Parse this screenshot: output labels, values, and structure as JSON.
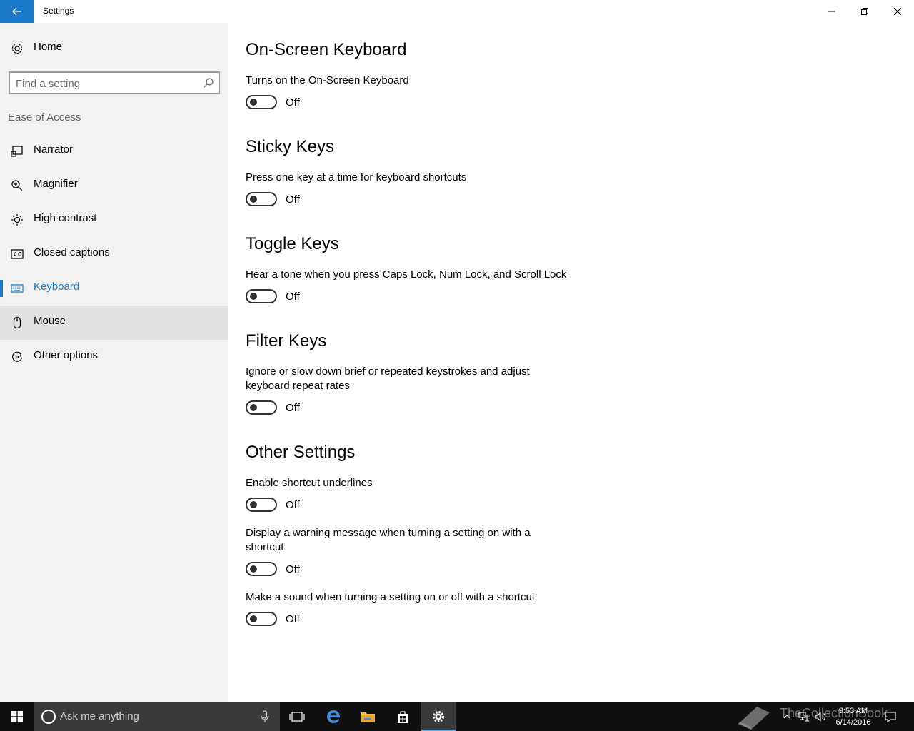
{
  "window": {
    "title": "Settings"
  },
  "sidebar": {
    "home_label": "Home",
    "search_placeholder": "Find a setting",
    "section_label": "Ease of Access",
    "items": [
      {
        "label": "Narrator",
        "icon": "narrator-icon"
      },
      {
        "label": "Magnifier",
        "icon": "magnifier-icon"
      },
      {
        "label": "High contrast",
        "icon": "high-contrast-icon"
      },
      {
        "label": "Closed captions",
        "icon": "closed-captions-icon"
      },
      {
        "label": "Keyboard",
        "icon": "keyboard-icon",
        "active": true
      },
      {
        "label": "Mouse",
        "icon": "mouse-icon",
        "hover": true
      },
      {
        "label": "Other options",
        "icon": "other-options-icon"
      }
    ]
  },
  "main": {
    "onscreen": {
      "heading": "On-Screen Keyboard",
      "desc": "Turns on the On-Screen Keyboard",
      "state": "Off"
    },
    "sticky": {
      "heading": "Sticky Keys",
      "desc": "Press one key at a time for keyboard shortcuts",
      "state": "Off"
    },
    "togglekeys": {
      "heading": "Toggle Keys",
      "desc": "Hear a tone when you press Caps Lock, Num Lock, and Scroll Lock",
      "state": "Off"
    },
    "filter": {
      "heading": "Filter Keys",
      "desc": "Ignore or slow down brief or repeated keystrokes and adjust keyboard repeat rates",
      "state": "Off"
    },
    "other": {
      "heading": "Other Settings",
      "underlines": {
        "desc": "Enable shortcut underlines",
        "state": "Off"
      },
      "warning": {
        "desc": "Display a warning message when turning a setting on with a shortcut",
        "state": "Off"
      },
      "sound": {
        "desc": "Make a sound when turning a setting on or off with a shortcut",
        "state": "Off"
      }
    }
  },
  "taskbar": {
    "search_text": "Ask me anything",
    "time": "9:53 AM",
    "date": "6/14/2016",
    "watermark": "TheCollectionBook"
  },
  "colors": {
    "accent": "#1979ca",
    "sidebar_bg": "#f2f2f2",
    "taskbar_bg": "#101010"
  }
}
